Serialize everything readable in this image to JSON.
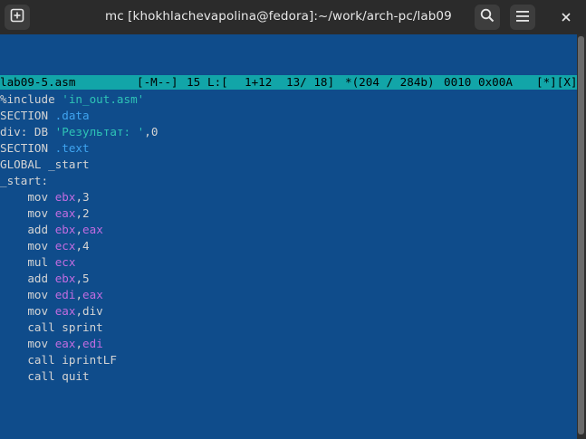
{
  "window": {
    "title": "mc [khokhlachevapolina@fedora]:~/work/arch-pc/lab09",
    "new_tab_icon": "new-tab-icon",
    "search_icon": "search-icon",
    "menu_icon": "hamburger-menu-icon",
    "close_icon": "close-icon"
  },
  "status": {
    "filename": "lab09-5.asm",
    "mode": "[-M--]",
    "col": "15",
    "line_label": "L:[",
    "line_pos": "1+12",
    "line_count": "13/ 18]",
    "offset": "*(204 / 284b)",
    "char_dec": "0010",
    "char_hex": "0x00A",
    "flags": "[*][X]"
  },
  "code": {
    "l1_kw": "%include",
    "l1_str": "'in_out.asm'",
    "l2_kw": "SECTION",
    "l2_sec": ".data",
    "l3_kw": "div: DB",
    "l3_str": "'Результат: '",
    "l3_tail": ",0",
    "l4_kw": "SECTION",
    "l4_sec": ".text",
    "l5_kw": "GLOBAL _start",
    "l6_kw": "_start:",
    "l7_op": "mov",
    "l7_reg": "ebx",
    "l7_tail": ",3",
    "l8_op": "mov",
    "l8_reg": "eax",
    "l8_tail": ",2",
    "l9_op": "add",
    "l9_reg1": "ebx",
    "l9_reg2": "eax",
    "l10_op": "mov",
    "l10_reg": "ecx",
    "l10_tail": ",4",
    "l11_op": "mul",
    "l11_reg": "ecx",
    "l12_op": "add",
    "l12_reg": "ebx",
    "l12_tail": ",5",
    "l13_op": "mov",
    "l13_reg1": "edi",
    "l13_reg2": "eax",
    "l14_op": "mov",
    "l14_reg": "eax",
    "l14_tail": ",div",
    "l15_op": "call sprint",
    "l16_op": "mov",
    "l16_reg1": "eax",
    "l16_reg2": "edi",
    "l17_op": "call iprintLF",
    "l18_op": "call quit"
  },
  "colors": {
    "editor_bg": "#0f4c8b",
    "statusbar_bg": "#12a5a8",
    "string": "#2ec4b6",
    "section": "#3fa4f0",
    "register": "#c16ce0"
  }
}
